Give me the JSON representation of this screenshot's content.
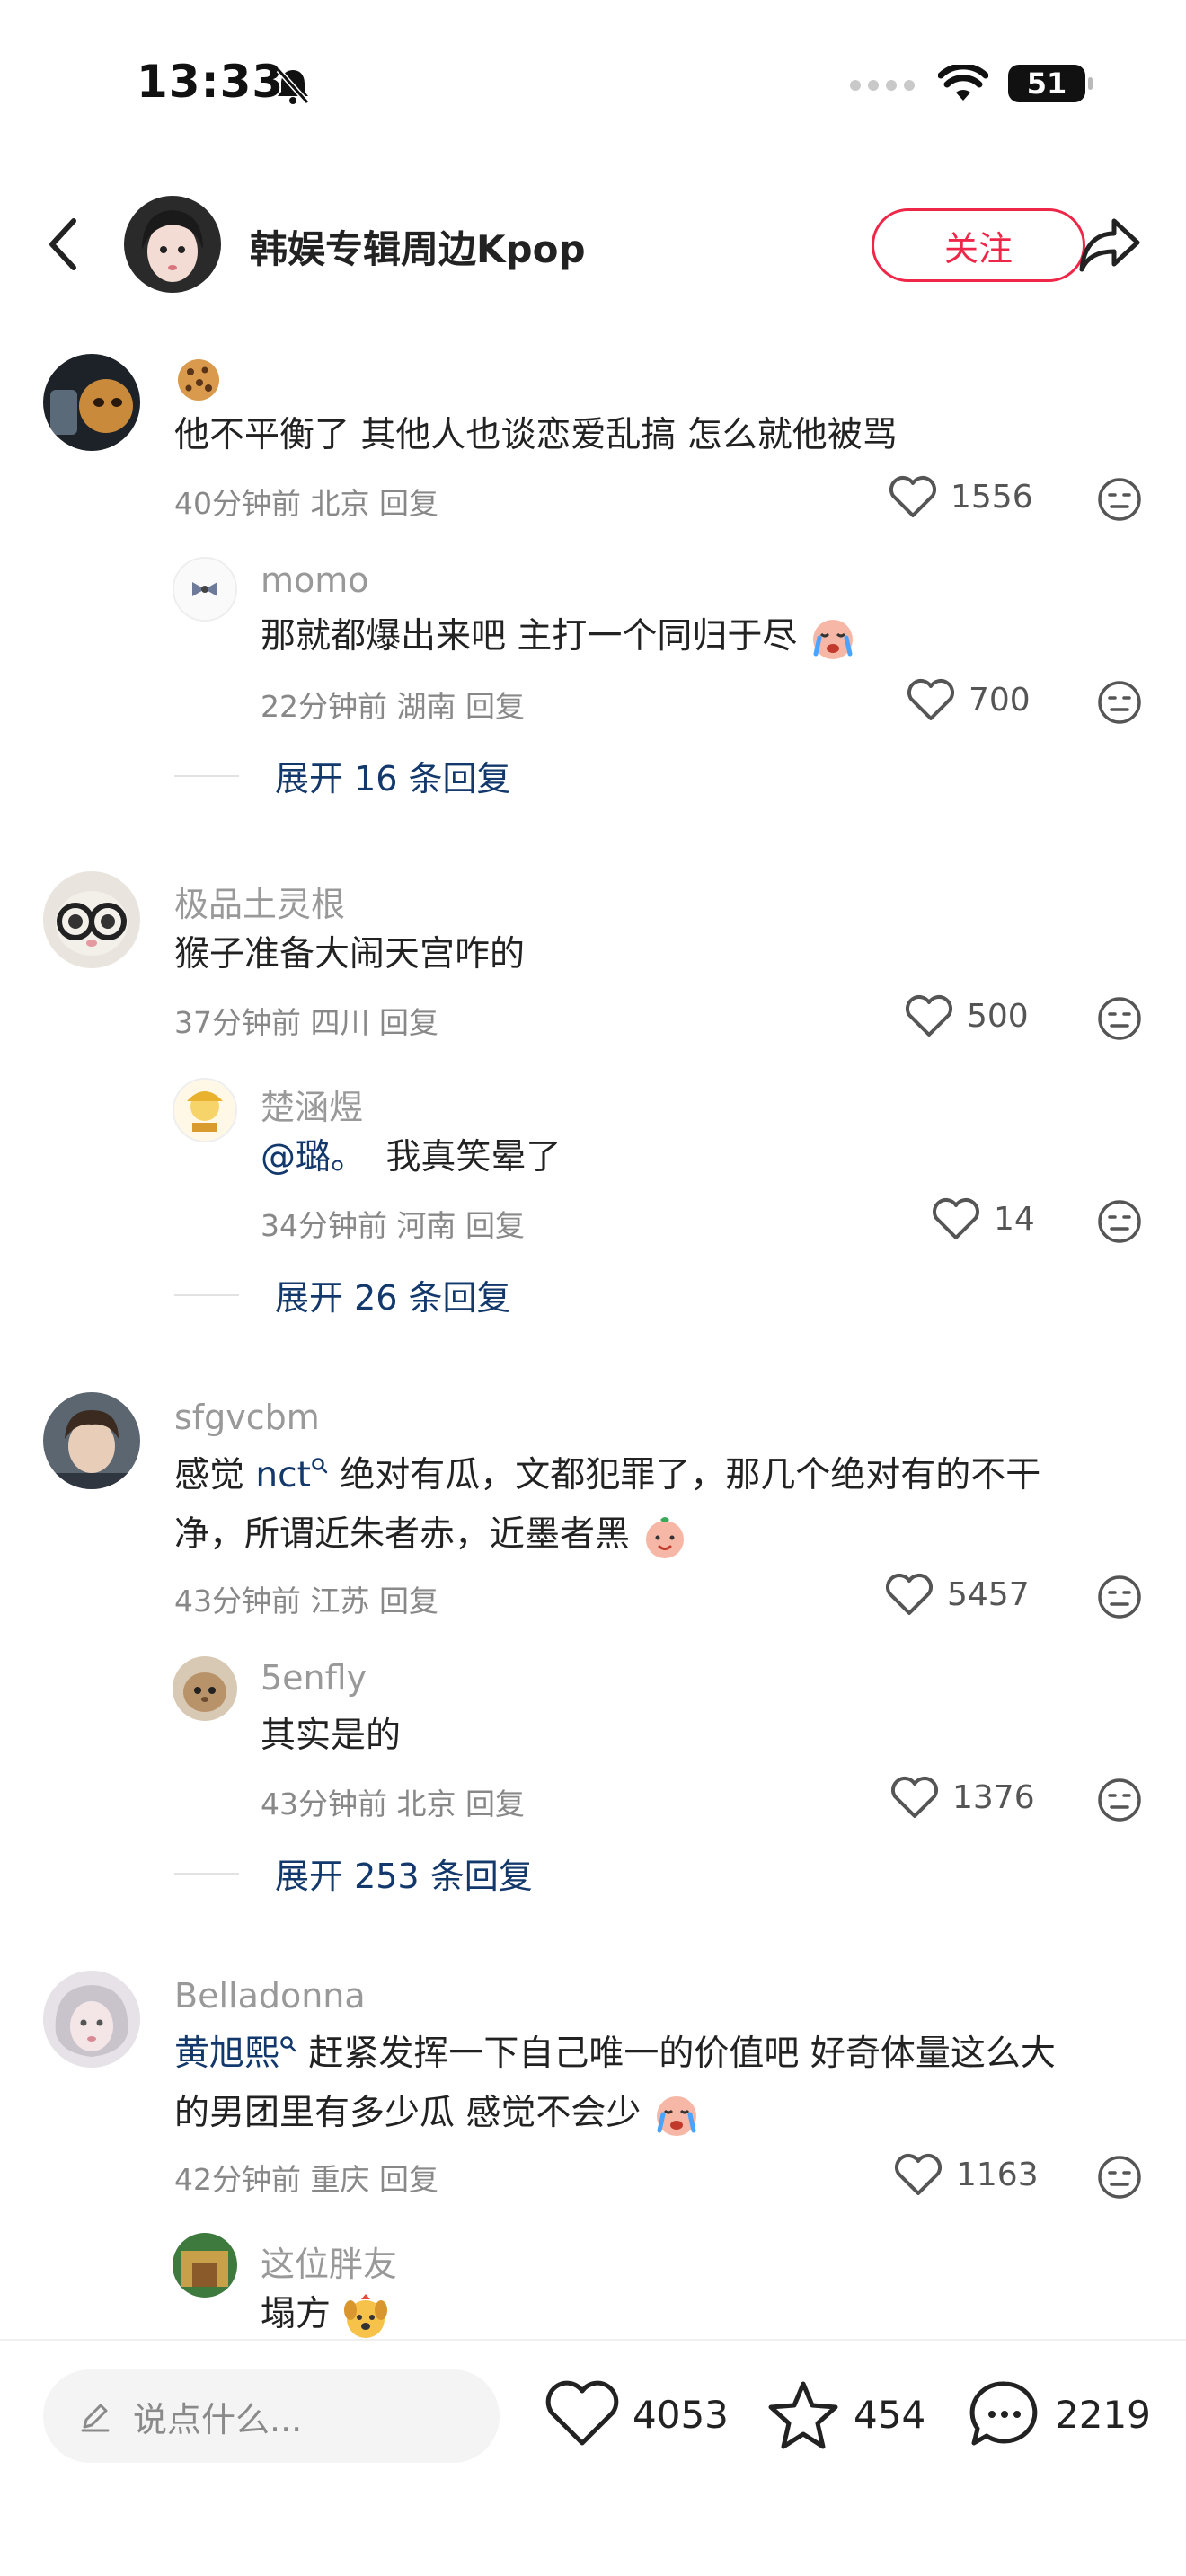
{
  "status_bar": {
    "time": "13:33",
    "battery": "51"
  },
  "header": {
    "title": "韩娱专辑周边Kpop",
    "follow_label": "关注"
  },
  "comments": [
    {
      "username": "",
      "text": "他不平衡了 其他人也谈恋爱乱搞 怎么就他被骂",
      "time": "40分钟前",
      "location": "北京",
      "reply_label": "回复",
      "likes": "1556",
      "reply": {
        "username": "momo",
        "text": "那就都爆出来吧 主打一个同归于尽",
        "time": "22分钟前",
        "location": "湖南",
        "reply_label": "回复",
        "likes": "700"
      },
      "expand_label": "展开 16 条回复"
    },
    {
      "username": "极品土灵根",
      "text": "猴子准备大闹天宫咋的",
      "time": "37分钟前",
      "location": "四川",
      "reply_label": "回复",
      "likes": "500",
      "reply": {
        "username": "楚涵煜",
        "mention": "@璐。",
        "text": "我真笑晕了",
        "time": "34分钟前",
        "location": "河南",
        "reply_label": "回复",
        "likes": "14"
      },
      "expand_label": "展开 26 条回复"
    },
    {
      "username": "sfgvcbm",
      "text_prefix": "感觉",
      "mention": "nct",
      "text_line1": "绝对有瓜，文都犯罪了，那几个绝对有的不干",
      "text_line2": "净，所谓近朱者赤，近墨者黑",
      "time": "43分钟前",
      "location": "江苏",
      "reply_label": "回复",
      "likes": "5457",
      "reply": {
        "username": "5enfly",
        "text": "其实是的",
        "time": "43分钟前",
        "location": "北京",
        "reply_label": "回复",
        "likes": "1376"
      },
      "expand_label": "展开 253 条回复"
    },
    {
      "username": "Belladonna",
      "mention": "黄旭熙",
      "text_line1": "赶紧发挥一下自己唯一的价值吧 好奇体量这么大",
      "text_line2": "的男团里有多少瓜 感觉不会少",
      "time": "42分钟前",
      "location": "重庆",
      "reply_label": "回复",
      "likes": "1163",
      "reply": {
        "username": "这位胖友",
        "text": "塌方"
      }
    }
  ],
  "bottom_bar": {
    "placeholder": "说点什么...",
    "likes": "4053",
    "favorites": "454",
    "comments": "2219"
  },
  "colors": {
    "accent_red": "#ee2748",
    "link_blue": "#13386c",
    "meta_gray": "#888888"
  },
  "icons": [
    "back-arrow-icon",
    "share-icon",
    "heart-icon",
    "dislike-face-icon",
    "star-icon",
    "comment-bubble-icon",
    "pencil-icon",
    "wifi-icon",
    "signal-icon",
    "bell-slash-icon"
  ]
}
